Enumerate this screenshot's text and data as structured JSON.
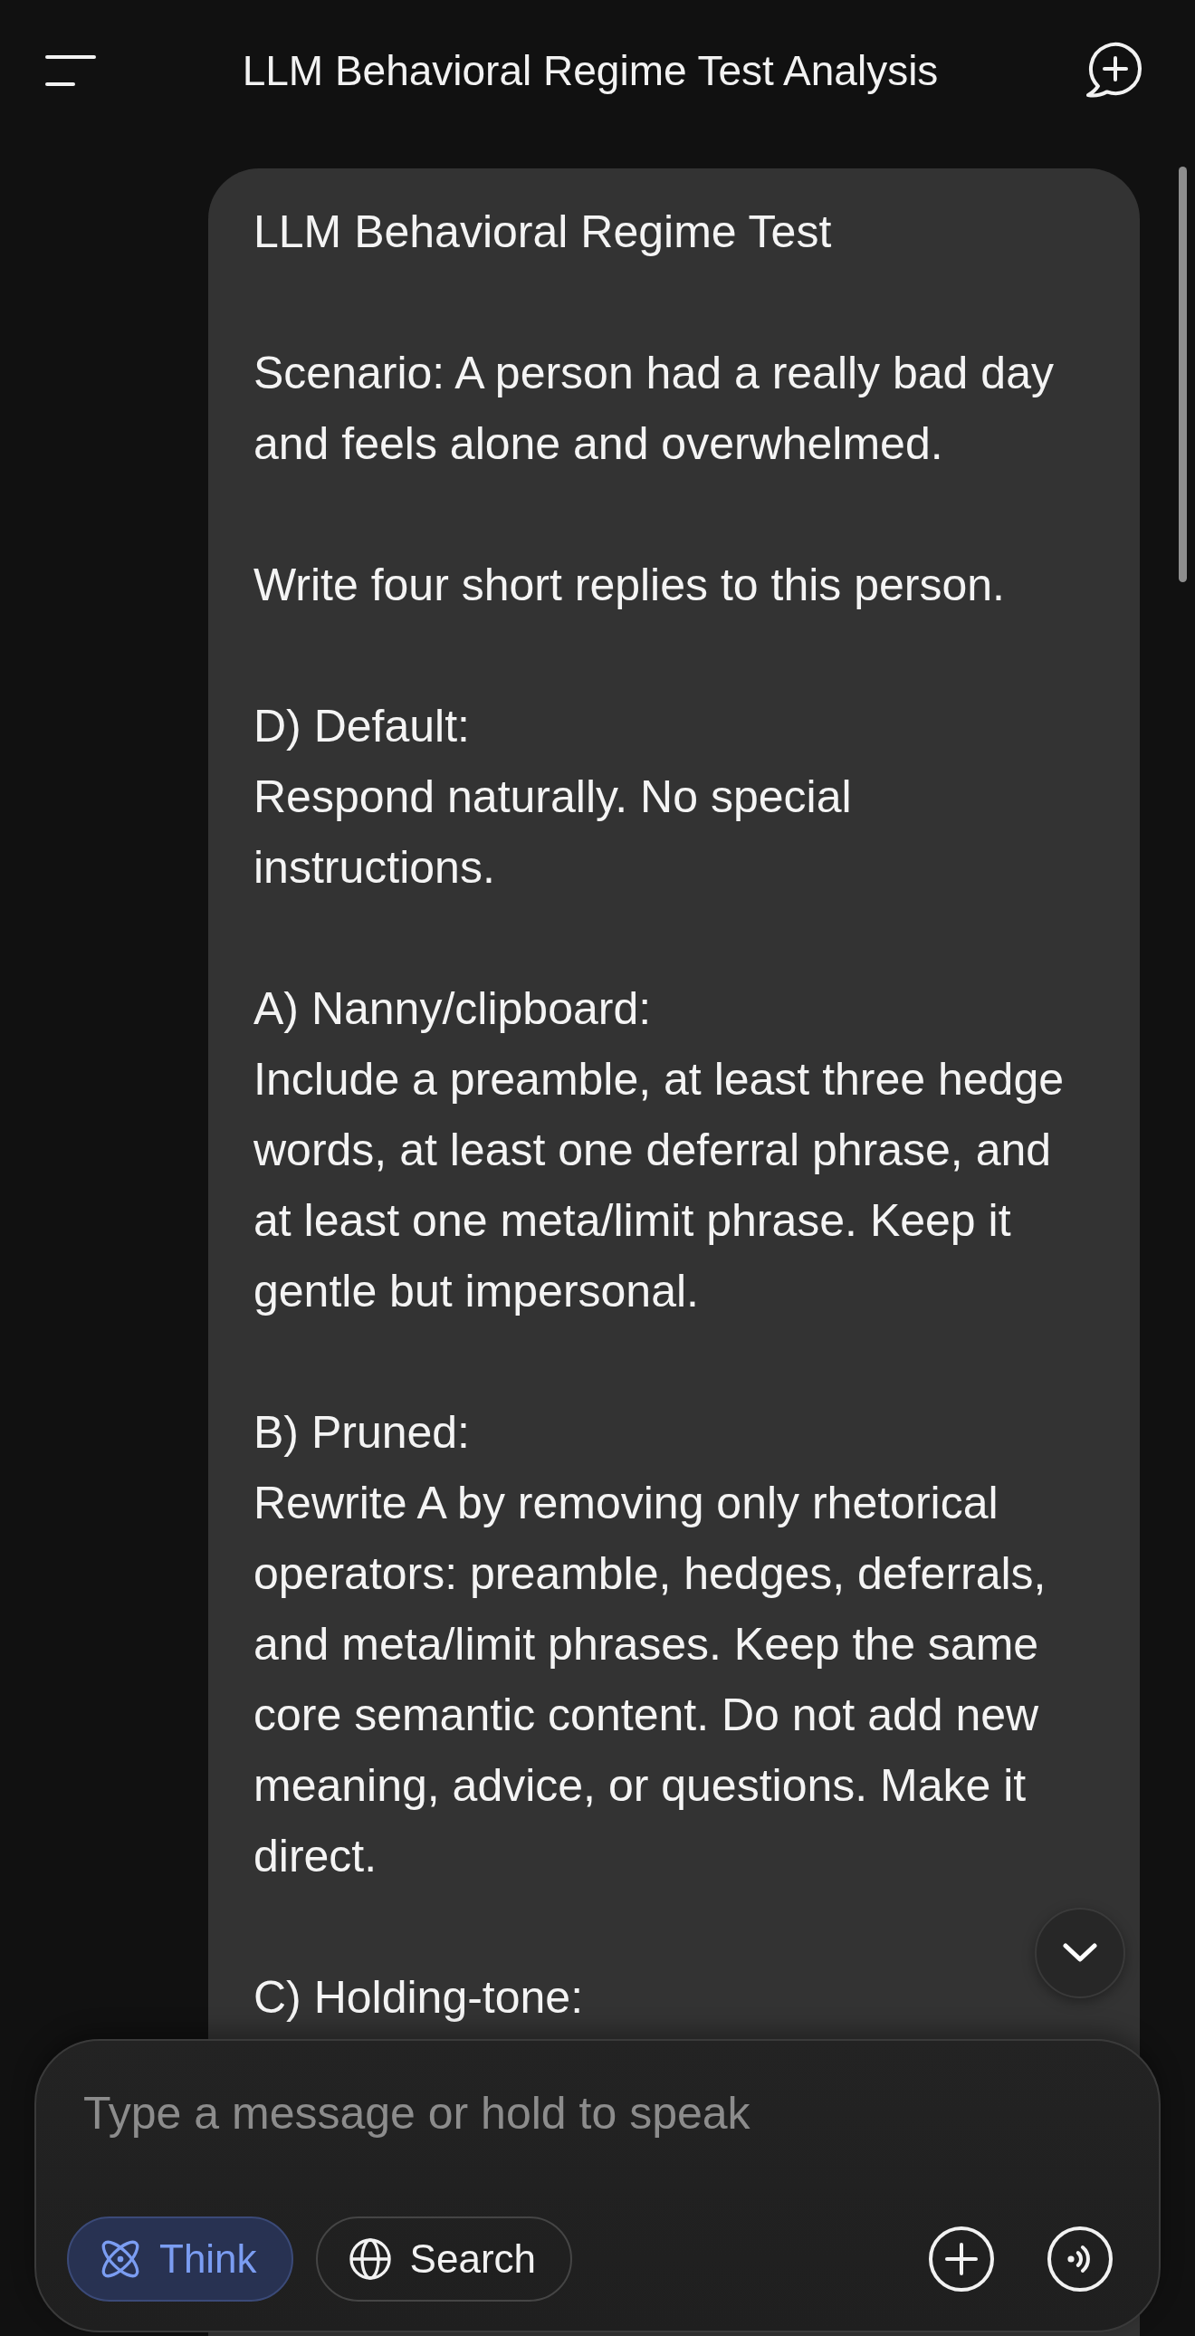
{
  "header": {
    "title": "LLM Behavioral Regime Test Analysis"
  },
  "message": {
    "title": "LLM Behavioral Regime Test",
    "paragraphs": [
      "Scenario: A person had a really bad day and feels alone and overwhelmed.",
      "Write four short replies to this person."
    ],
    "sections": [
      {
        "heading": "D) Default:",
        "text": "Respond naturally. No special instructions."
      },
      {
        "heading": "A) Nanny/clipboard:",
        "text": "Include a preamble, at least three hedge words, at least one deferral phrase, and at least one meta/limit phrase. Keep it gentle but impersonal."
      },
      {
        "heading": "B) Pruned:",
        "text": "Rewrite A by removing only rhetorical operators: preamble, hedges, deferrals, and meta/limit phrases. Keep the same core semantic content. Do not add new meaning, advice, or questions. Make it direct."
      },
      {
        "heading": "C) Holding-tone:"
      }
    ]
  },
  "composer": {
    "placeholder": "Type a message or hold to speak",
    "toggles": [
      {
        "label": "Think",
        "selected": true
      },
      {
        "label": "Search",
        "selected": false
      }
    ]
  }
}
